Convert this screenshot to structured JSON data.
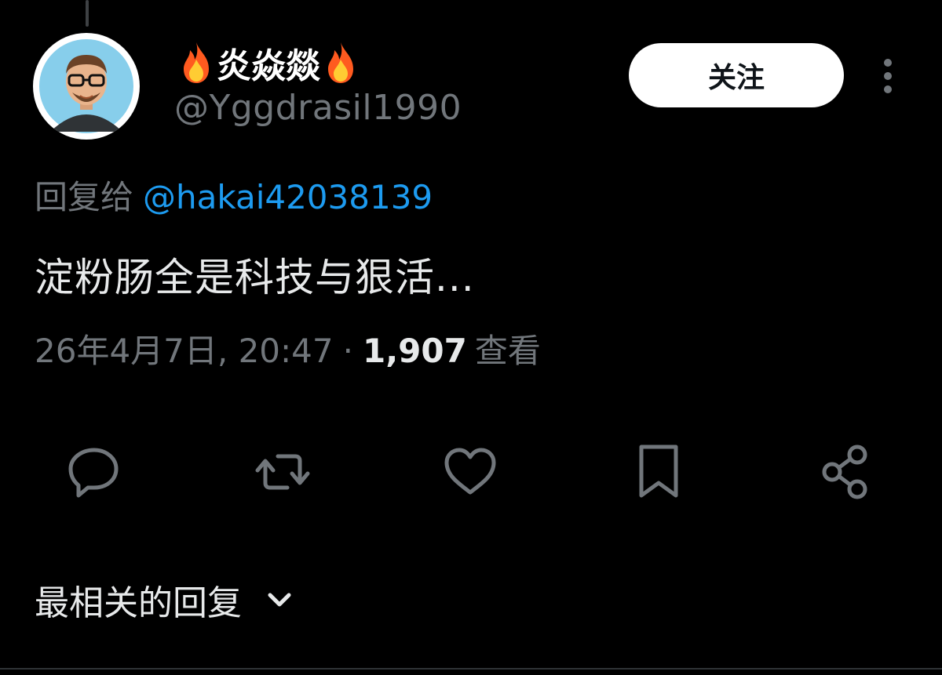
{
  "author": {
    "display_name": "炎焱燚",
    "handle": "@Yggdrasil1990",
    "avatar_icon": "cartoon-man-with-glasses-avatar",
    "name_emoji": "fire-icon"
  },
  "follow_button": {
    "label": "关注"
  },
  "more_menu": {
    "icon": "more-vertical-icon"
  },
  "reply_to": {
    "label": "回复给",
    "mention": "@hakai42038139"
  },
  "tweet": {
    "text": "淀粉肠全是科技与狠活..."
  },
  "meta": {
    "timestamp": "26年4月7日, 20:47",
    "separator": "·",
    "views_count": "1,907",
    "views_label": "查看"
  },
  "actions": [
    {
      "name": "reply",
      "icon": "reply-icon"
    },
    {
      "name": "retweet",
      "icon": "retweet-icon"
    },
    {
      "name": "like",
      "icon": "heart-icon"
    },
    {
      "name": "bookmark",
      "icon": "bookmark-icon"
    },
    {
      "name": "share",
      "icon": "share-icon"
    }
  ],
  "replies_sort": {
    "label": "最相关的回复",
    "icon": "chevron-down-icon"
  },
  "colors": {
    "background": "#000000",
    "text_primary": "#e7e9ea",
    "text_secondary": "#71767b",
    "link": "#1d9bf0",
    "icon": "#71767b",
    "follow_bg": "#ffffff"
  }
}
